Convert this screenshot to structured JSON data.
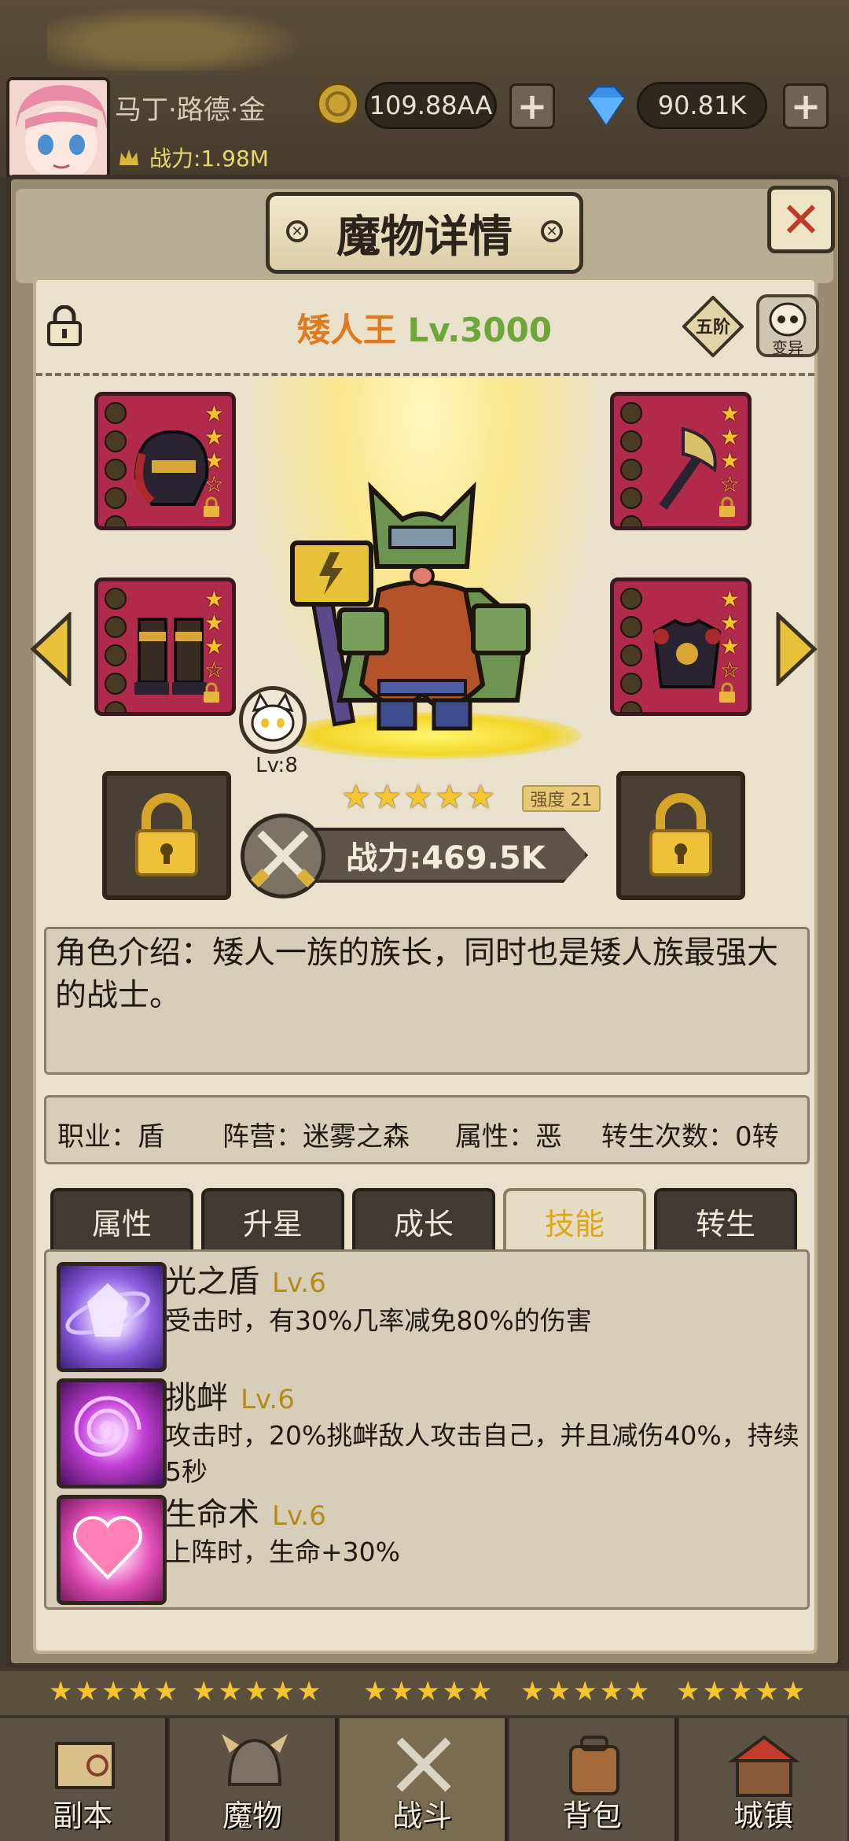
{
  "player": {
    "name": "马丁·路德·金",
    "power": "战力:1.98M"
  },
  "currency": {
    "gold": "109.88AA",
    "gems": "90.81K",
    "plus": "+"
  },
  "panel": {
    "title": "魔物详情",
    "close": "✕",
    "rivet": "✕"
  },
  "monster": {
    "name": "矮人王",
    "level": "Lv.3000",
    "stage": "五阶",
    "mutate": "变异",
    "stars": "★★★★★",
    "strength": "强度 21",
    "power": "战力:469.5K",
    "pet_level": "Lv:8",
    "description": "角色介绍：矮人一族的族长，同时也是矮人族最强大的战士。"
  },
  "info": {
    "job": "职业：盾",
    "camp": "阵营：迷雾之森",
    "attr": "属性：恶",
    "rebirth": "转生次数：0转"
  },
  "tabs": [
    "属性",
    "升星",
    "成长",
    "技能",
    "转生"
  ],
  "active_tab": "技能",
  "skills": [
    {
      "name": "光之盾",
      "level": "Lv.6",
      "desc": "受击时，有30%几率减免80%的伤害",
      "color": "#8f5ee0"
    },
    {
      "name": "挑衅",
      "level": "Lv.6",
      "desc": "攻击时，20%挑衅敌人攻击自己，并且减伤40%，持续5秒",
      "color": "#c23ed6"
    },
    {
      "name": "生命术",
      "level": "Lv.6",
      "desc": "上阵时，生命+30%",
      "color": "#e34fb8"
    }
  ],
  "equipment": {
    "star_full": "★",
    "star_empty": "☆",
    "slots": [
      {
        "stars_filled": 3,
        "stars_total": 4
      },
      {
        "stars_filled": 3,
        "stars_total": 4
      },
      {
        "stars_filled": 3,
        "stars_total": 4
      },
      {
        "stars_filled": 3,
        "stars_total": 4
      }
    ]
  },
  "bottom_stars": "★★★★★",
  "nav": [
    "副本",
    "魔物",
    "战斗",
    "背包",
    "城镇"
  ],
  "nav_active": "战斗",
  "colors": {
    "accent_gold": "#f6c52d",
    "name_orange": "#e07a1f",
    "level_green": "#6ea63a",
    "slot_red": "#b12a4b"
  }
}
